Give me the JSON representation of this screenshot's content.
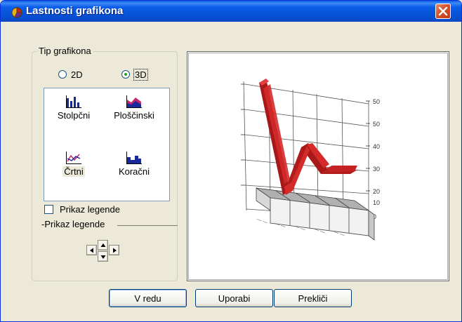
{
  "window": {
    "title": "Lastnosti grafikona"
  },
  "chart_type_group": {
    "label": "Tip grafikona",
    "radio_2d": "2D",
    "radio_3d": "3D",
    "selected": "3D"
  },
  "chart_types": [
    {
      "label": "Stolpčni",
      "icon": "bar-chart-icon"
    },
    {
      "label": "Ploščinski",
      "icon": "area-chart-icon"
    },
    {
      "label": "Črtni",
      "icon": "line-chart-icon",
      "selected": true
    },
    {
      "label": "Koračni",
      "icon": "step-chart-icon"
    }
  ],
  "legend": {
    "checkbox_label": "Prikaz legende",
    "checked": false,
    "position_label": "-Prikaz legende"
  },
  "buttons": {
    "ok": "V redu",
    "apply": "Uporabi",
    "cancel": "Prekliči"
  },
  "preview": {
    "axis_ticks": [
      "50",
      "50",
      "40",
      "30",
      "20",
      "10",
      "0"
    ],
    "accent": "#d42a2a"
  }
}
